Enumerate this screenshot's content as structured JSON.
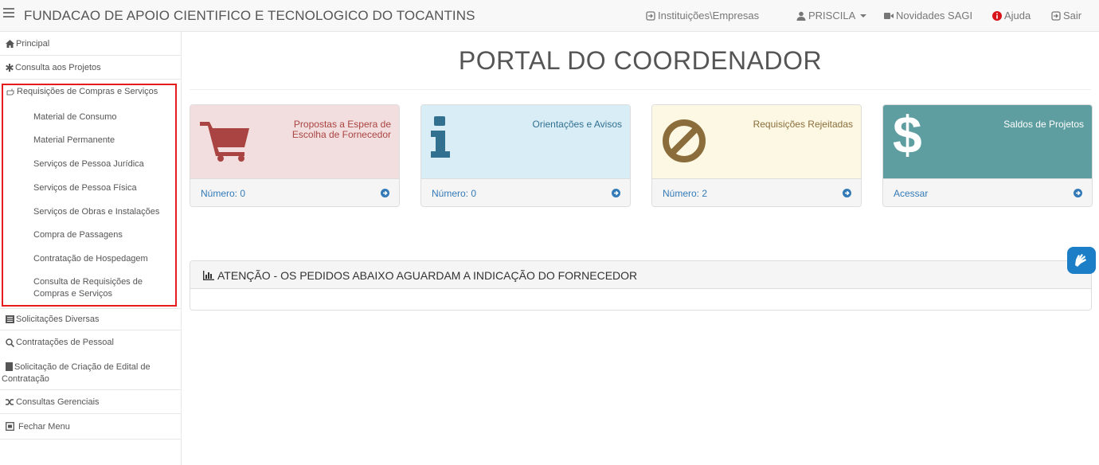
{
  "header": {
    "brand": "FUNDACAO DE APOIO CIENTIFICO E TECNOLOGICO DO TOCANTINS",
    "nav": {
      "institutions": "Instituições\\Empresas",
      "user": "PRISCILA",
      "news": "Novidades SAGI",
      "help": "Ajuda",
      "exit": "Sair"
    }
  },
  "sidebar": {
    "principal": "Principal",
    "consulta_projetos": "Consulta aos Projetos",
    "requisicoes": "Requisições de Compras e Serviços",
    "submenu": [
      "Material de Consumo",
      "Material Permanente",
      "Serviços de Pessoa Jurídica",
      "Serviços de Pessoa Física",
      "Serviços de Obras e Instalações",
      "Compra de Passagens",
      "Contratação de Hospedagem",
      "Consulta de Requisições de Compras e Serviços"
    ],
    "solicitacoes": "Solicitações Diversas",
    "contratacoes": "Contratações de Pessoal",
    "edital": "Solicitação de Criação de Edital de Contratação",
    "gerenciais": "Consultas Gerenciais",
    "fechar": "Fechar Menu"
  },
  "main": {
    "title": "PORTAL DO COORDENADOR",
    "panels": [
      {
        "title": "Propostas a Espera de Escolha de Fornecedor",
        "footer": "Número: 0",
        "icon": "shopping-cart-icon"
      },
      {
        "title": "Orientações e Avisos",
        "footer": "Número: 0",
        "icon": "info-icon"
      },
      {
        "title": "Requisições Rejeitadas",
        "footer": "Número: 2",
        "icon": "ban-icon"
      },
      {
        "title": "Saldos de Projetos",
        "footer": "Acessar",
        "icon": "dollar-icon"
      }
    ],
    "attention": "ATENÇÃO - OS PEDIDOS ABAIXO AGUARDAM A INDICAÇÃO DO FORNECEDOR"
  },
  "colors": {
    "danger_bg": "#f2dede",
    "info_bg": "#d9edf7",
    "warning_bg": "#fcf8e3",
    "teal_bg": "#5f9ea0",
    "link": "#337ab7",
    "highlight_border": "#e51c1c"
  }
}
